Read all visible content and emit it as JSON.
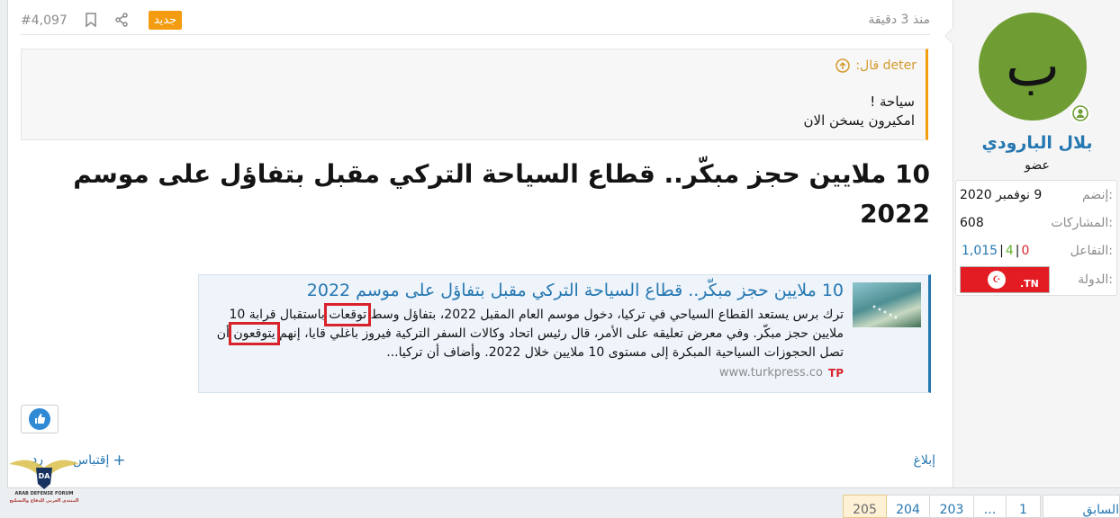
{
  "user": {
    "avatar_letter": "ب",
    "name": "بلال البارودي",
    "title": "عضو",
    "stats": {
      "joined_label": "إنضم:",
      "joined_value": "9 نوفمبر 2020",
      "posts_label": "المشاركات:",
      "posts_value": "608",
      "reactions_label": "التفاعل:",
      "reactions_positive": "1,015",
      "reactions_neutral": "4",
      "reactions_negative": "0",
      "country_label": "الدولة:",
      "country_flag_text": ".TN"
    }
  },
  "post": {
    "time": "منذ 3 دقيقة",
    "number": "#4,097",
    "new_badge": "جديد",
    "quote": {
      "author": "deter قال:",
      "line1": "سياحة !",
      "line2": "امكيرون يسخن الان"
    },
    "title": "10 ملايين حجز مبكّر.. قطاع السياحة التركي مقبل بتفاؤل على موسم 2022",
    "embed": {
      "title": "10 ملايين حجز مبكّر.. قطاع السياحة التركي مقبل بتفاؤل على موسم 2022",
      "desc_part1": "ترك برس يستعد القطاع السياحي في تركيا، دخول موسم العام المقبل 2022، بتفاؤل وسط ",
      "highlight1": "توقعات",
      "desc_part2": " باستقبال قرابة 10 ملايين حجز مبكّر. وفي معرض تعليقه على الأمر، قال رئيس اتحاد وكالات السفر التركية فيروز باغلي قايا، إنهم ",
      "highlight2": "يتوقعون",
      "desc_part3": " أن تصل الحجوزات السياحية المبكرة إلى مستوى 10 ملايين خلال 2022. وأضاف أن تركيا...",
      "source": "www.turkpress.co"
    },
    "footer": {
      "report": "إبلاغ",
      "quote": "إقتباس",
      "reply": "رد"
    },
    "watermark_title": "ARAB DEFENSE FORUM",
    "watermark_sub": "المنتدى العربي للدفاع والتسليح",
    "watermark_abbr": "DA"
  },
  "pagination": {
    "prev": "السابق",
    "pages": [
      "205",
      "204",
      "203",
      "…",
      "1"
    ],
    "current": "205"
  },
  "colors": {
    "link": "#2577b1",
    "accent": "#f39c11",
    "avatar_bg": "#6f9d33",
    "highlight_box": "#d8232a"
  }
}
